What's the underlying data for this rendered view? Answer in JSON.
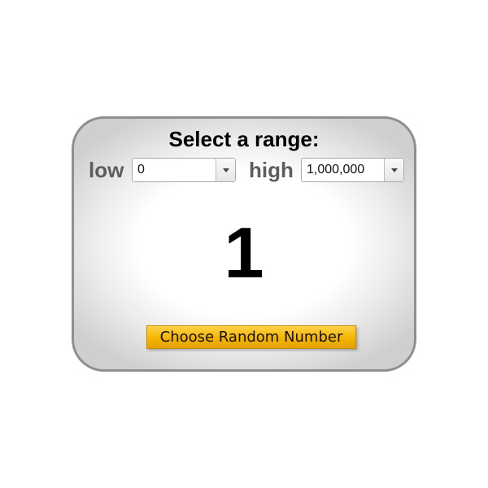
{
  "title": "Select a range:",
  "low": {
    "label": "low",
    "selected": "0"
  },
  "high": {
    "label": "high",
    "selected": "1,000,000"
  },
  "result": "1",
  "button_label": "Choose Random Number",
  "colors": {
    "button": "#f5b400",
    "border": "#8f8f8f",
    "label": "#5c5c5c"
  }
}
